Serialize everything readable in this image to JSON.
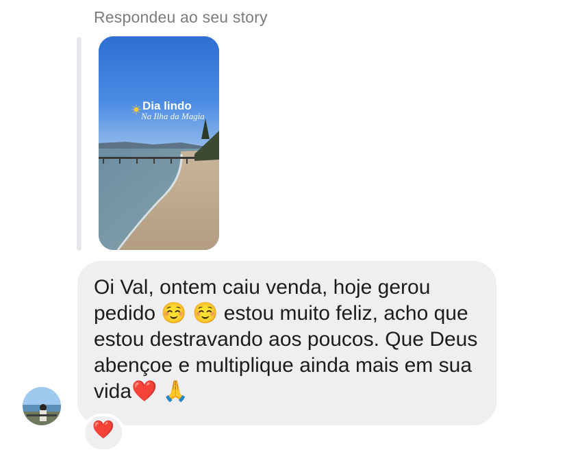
{
  "header": {
    "reply_label": "Respondeu ao seu story"
  },
  "story": {
    "title": "Dia lindo",
    "subtitle": "Na Ilha da Magia",
    "icon": "sun-icon"
  },
  "message": {
    "text": "Oi Val, ontem caiu venda, hoje gerou pedido ☺️ ☺️ estou muito feliz, acho que estou destravando aos poucos. Que Deus abençoe e multiplique ainda mais em sua vida❤️ 🙏"
  },
  "reaction": {
    "emoji": "❤️"
  },
  "colors": {
    "bubble_bg": "#efeff1",
    "label_gray": "#7b7b80",
    "text_dark": "#1c1c1e",
    "heart_red": "#e0141f"
  }
}
